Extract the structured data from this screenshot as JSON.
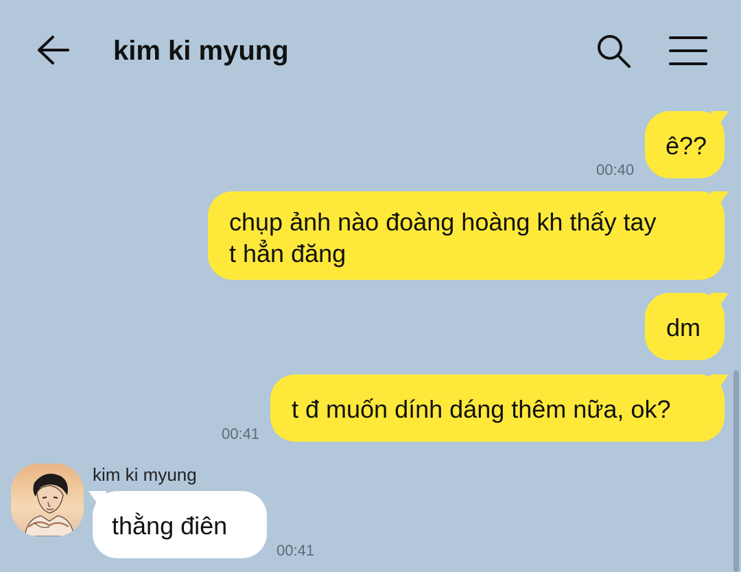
{
  "header": {
    "back_icon": "arrow-left-icon",
    "title": "kim ki myung",
    "search_icon": "search-icon",
    "menu_icon": "hamburger-menu-icon"
  },
  "messages": [
    {
      "from": "me",
      "text": "ê??",
      "time": "00:40"
    },
    {
      "from": "me",
      "text_lines": [
        "chụp ảnh nào đoàng hoàng kh thấy tay",
        "t hẳn đăng"
      ]
    },
    {
      "from": "me",
      "text": "dm"
    },
    {
      "from": "me",
      "text": "t đ muốn dính dáng thêm nữa, ok?",
      "time": "00:41"
    },
    {
      "from": "other",
      "sender": "kim ki myung",
      "text": "thằng điên",
      "time": "00:41"
    }
  ],
  "colors": {
    "background": "#b2c7da",
    "my_bubble": "#fee93a",
    "other_bubble": "#ffffff"
  }
}
